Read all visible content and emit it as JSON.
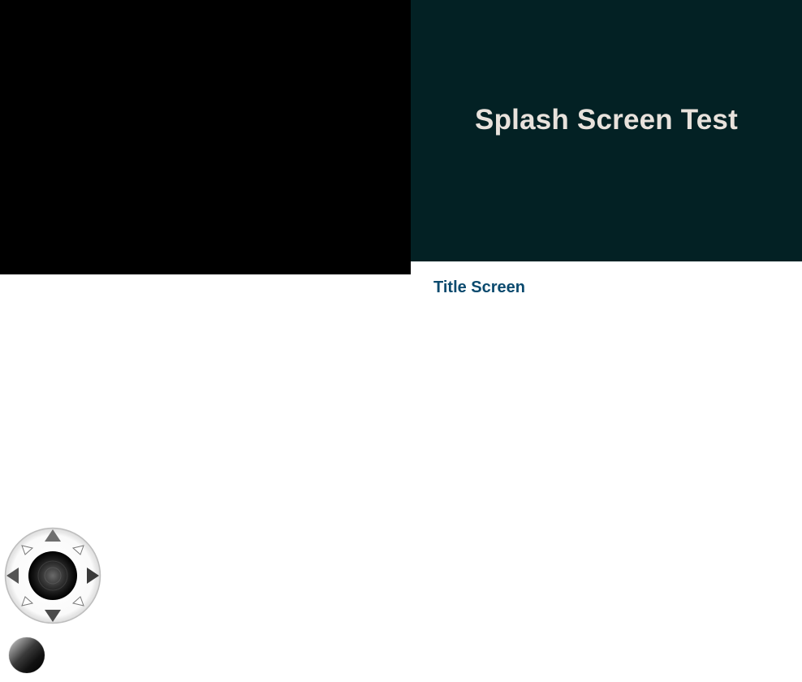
{
  "splash": {
    "title": "Splash Screen Test",
    "background": "#032124",
    "text_color": "#e8e2dc"
  },
  "navigation": {
    "title_screen_label": "Title Screen",
    "link_color": "#0b4a6e"
  },
  "game_viewport": {
    "background": "#000000"
  },
  "controls": {
    "dpad_icon": "directional-pad-icon",
    "directions": [
      "up",
      "down",
      "left",
      "right",
      "up-left",
      "up-right",
      "down-left",
      "down-right"
    ],
    "action_button_icon": "action-button-icon"
  }
}
